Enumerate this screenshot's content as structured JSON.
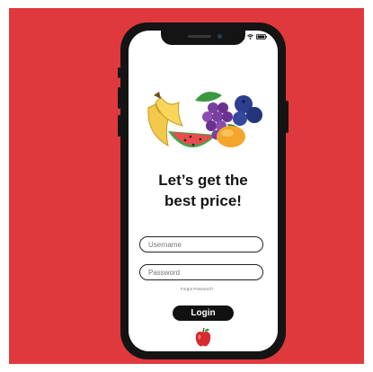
{
  "colors": {
    "background": "#e0393d",
    "phone_frame": "#141414",
    "screen": "#ffffff",
    "button": "#111111",
    "button_text": "#ffffff"
  },
  "icons": [
    "fruit-illustration-icon",
    "signal-icon",
    "wifi-icon",
    "battery-icon",
    "apple-icon"
  ],
  "login_screen": {
    "title_line1": "Let’s get the",
    "title_line2": "best price!",
    "username_placeholder": "Username",
    "password_placeholder": "Password",
    "forgot_password": "Forgot Password?",
    "login_button": "Login"
  }
}
